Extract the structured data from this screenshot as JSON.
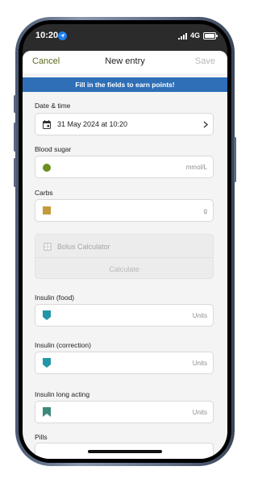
{
  "status_bar": {
    "time": "10:20",
    "network": "4G"
  },
  "nav": {
    "cancel": "Cancel",
    "title": "New entry",
    "save": "Save"
  },
  "banner": "Fill in the fields to earn points!",
  "date_time": {
    "label": "Date & time",
    "value": "31 May 2024 at 10:20"
  },
  "blood_sugar": {
    "label": "Blood sugar",
    "unit": "mmol/L",
    "color": "#6e8e1f"
  },
  "carbs": {
    "label": "Carbs",
    "unit": "g",
    "color": "#c49a3c"
  },
  "bolus": {
    "title": "Bolus Calculator",
    "action": "Calculate"
  },
  "insulin_food": {
    "label": "Insulin (food)",
    "unit": "Units",
    "color": "#2296a8"
  },
  "insulin_correction": {
    "label": "Insulin (correction)",
    "unit": "Units",
    "color": "#2296a8"
  },
  "insulin_long": {
    "label": "Insulin long acting",
    "unit": "Units",
    "color": "#3a8a7a"
  },
  "pills": {
    "label": "Pills"
  },
  "colors": {
    "accent_green": "#5c6a1e",
    "banner_blue": "#2e6fb7"
  }
}
